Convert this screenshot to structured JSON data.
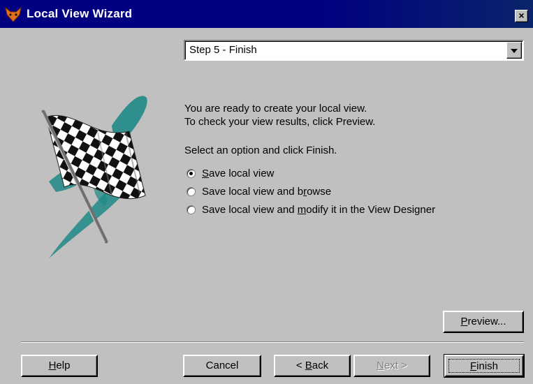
{
  "window": {
    "title": "Local View Wizard",
    "close_label": "×"
  },
  "step_select": {
    "value": "Step 5 - Finish"
  },
  "intro": {
    "line1": "You are ready to create your local view.",
    "line2": "To check your view results, click Preview.",
    "line3": "Select an option and click Finish."
  },
  "options": [
    {
      "pre": "",
      "mn": "S",
      "post": "ave local view",
      "checked": true
    },
    {
      "pre": "Save local view and b",
      "mn": "r",
      "post": "owse",
      "checked": false
    },
    {
      "pre": "Save local view and ",
      "mn": "m",
      "post": "odify it in the View Designer",
      "checked": false
    }
  ],
  "buttons": {
    "preview": {
      "mn": "P",
      "rest": "review..."
    },
    "help": {
      "mn": "H",
      "rest": "elp"
    },
    "cancel": "Cancel",
    "back": {
      "pre": "< ",
      "mn": "B",
      "post": "ack"
    },
    "next": {
      "mn": "N",
      "post": "ext >"
    },
    "finish": {
      "mn": "F",
      "post": "inish"
    }
  },
  "colors": {
    "titlebar": "#000080",
    "face": "#c0c0c0",
    "teal_brush": "#1f8a86"
  },
  "icons": {
    "app": "fox-icon",
    "art": "checkered-flag-icon"
  }
}
